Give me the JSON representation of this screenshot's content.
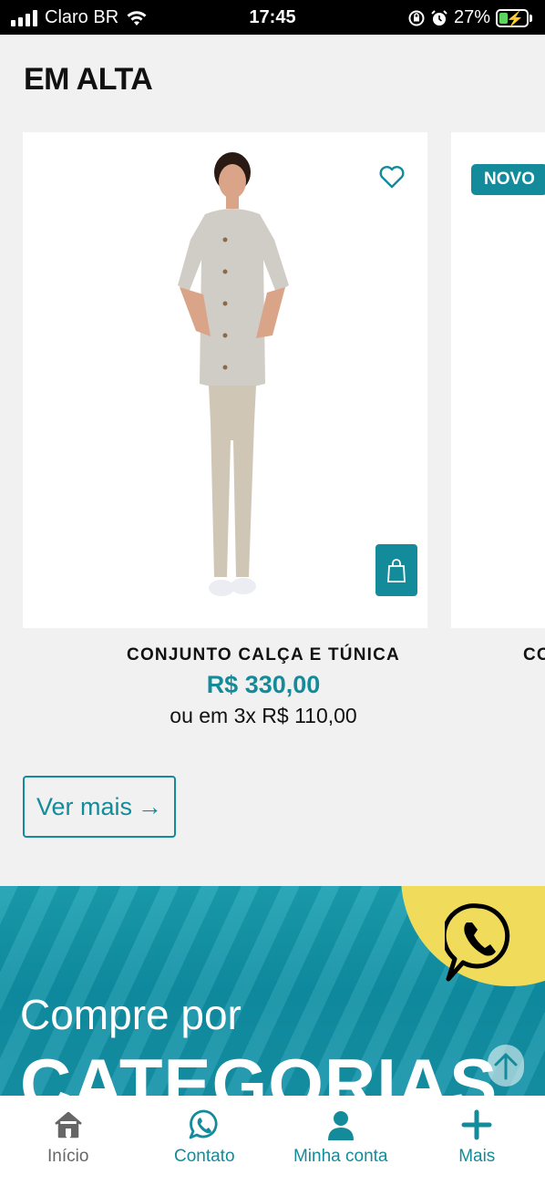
{
  "status_bar": {
    "carrier": "Claro BR",
    "time": "17:45",
    "battery": "27%"
  },
  "section": {
    "title": "EM ALTA"
  },
  "products": [
    {
      "name": "CONJUNTO CALÇA E TÚNICA",
      "price": "R$ 330,00",
      "installments": "ou em 3x R$ 110,00",
      "icons": [
        "heart-icon",
        "shopping-bag-icon"
      ]
    },
    {
      "badge": "NOVO",
      "name_partial": "CO"
    }
  ],
  "actions": {
    "see_more": "Ver mais",
    "see_more_arrow": "→"
  },
  "banner": {
    "small_text": "Compre por",
    "big_text": "CATEGORIAS"
  },
  "bottom_nav": {
    "items": [
      {
        "label": "Início",
        "icon": "home-icon"
      },
      {
        "label": "Contato",
        "icon": "whatsapp-icon"
      },
      {
        "label": "Minha conta",
        "icon": "user-icon"
      },
      {
        "label": "Mais",
        "icon": "plus-icon"
      }
    ]
  },
  "colors": {
    "accent": "#138b9a",
    "background": "#f1f1f1",
    "banner_yellow": "#f0dc5a"
  }
}
